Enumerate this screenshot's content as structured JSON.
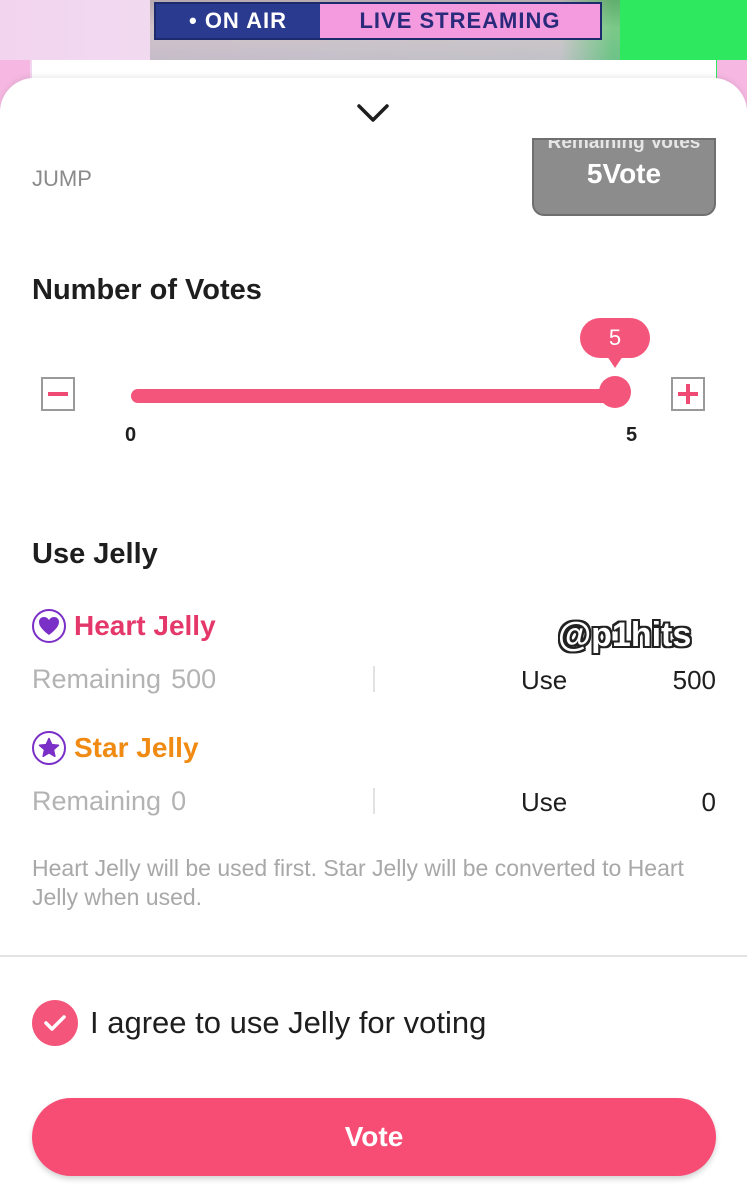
{
  "banner": {
    "on_air": "• ON AIR",
    "live_streaming": "LIVE STREAMING"
  },
  "header": {
    "jump_label": "JUMP",
    "remaining_votes_label": "Remaining Votes",
    "remaining_votes_value": "5Vote"
  },
  "votes": {
    "title": "Number of Votes",
    "current": 5,
    "current_label": "5",
    "min": 0,
    "max": 5,
    "min_label": "0",
    "max_label": "5",
    "decrement_icon": "minus-icon",
    "increment_icon": "plus-icon"
  },
  "jelly": {
    "title": "Use Jelly",
    "heart": {
      "name": "Heart Jelly",
      "icon": "heart-icon",
      "color": "#e5386a",
      "remaining_label": "Remaining",
      "remaining_value": "500",
      "use_label": "Use",
      "use_value": "500"
    },
    "star": {
      "name": "Star Jelly",
      "icon": "star-icon",
      "color": "#f08a12",
      "remaining_label": "Remaining",
      "remaining_value": "0",
      "use_label": "Use",
      "use_value": "0"
    },
    "note": "Heart Jelly will be used first. Star Jelly will be converted to Heart Jelly when used."
  },
  "watermark": "@p1hits",
  "agree": {
    "checked": true,
    "text": "I agree to use Jelly for voting"
  },
  "vote_button": "Vote",
  "colors": {
    "accent": "#f4557a",
    "icon_purple": "#7a2fc7"
  }
}
